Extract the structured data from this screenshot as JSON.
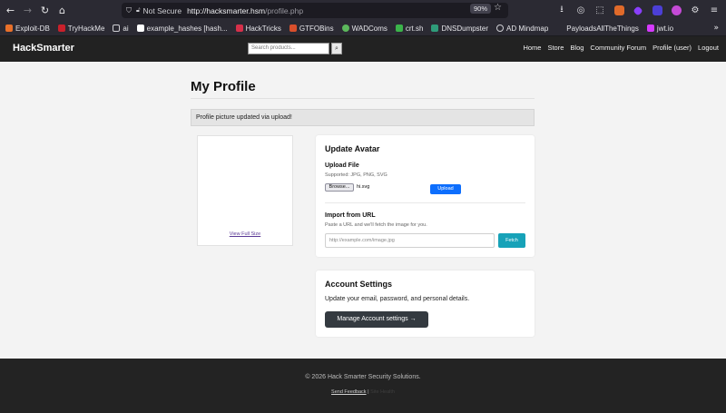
{
  "browser": {
    "security_label": "Not Secure",
    "url_host": "http://hacksmarter.hsm",
    "url_path": "/profile.php",
    "zoom": "90%",
    "bookmarks": [
      {
        "label": "Exploit-DB",
        "color": "#e8702a"
      },
      {
        "label": "TryHackMe",
        "color": "#c9202b"
      },
      {
        "label": "ai",
        "color": "#cfcfd4"
      },
      {
        "label": "example_hashes [hash...",
        "color": "#ffffff"
      },
      {
        "label": "HackTricks",
        "color": "#d6304a"
      },
      {
        "label": "GTFOBins",
        "color": "#d94f2b"
      },
      {
        "label": "WADComs",
        "color": "#5cb85c"
      },
      {
        "label": "crt.sh",
        "color": "#3bb44a"
      },
      {
        "label": "DNSDumpster",
        "color": "#2f9c7a"
      },
      {
        "label": "AD Mindmap",
        "color": "#cfcfd4"
      },
      {
        "label": "PayloadsAllTheThings",
        "color": "#2b2a33"
      },
      {
        "label": "jwt.io",
        "color": "#d63aff"
      }
    ]
  },
  "site": {
    "brand": "HackSmarter",
    "search_placeholder": "Search products...",
    "nav_links": [
      "Home",
      "Store",
      "Blog",
      "Community Forum",
      "Profile (user)",
      "Logout"
    ]
  },
  "profile": {
    "title": "My Profile",
    "alert": "Profile picture updated via upload!",
    "view_full_size": "View Full Size"
  },
  "avatar_card": {
    "heading": "Update Avatar",
    "upload_heading": "Upload File",
    "supported": "Supported: JPG, PNG, SVG",
    "browse_label": "Browse...",
    "file_name": "hi.svg",
    "upload_label": "Upload",
    "import_heading": "Import from URL",
    "import_hint": "Paste a URL and we'll fetch the image for you.",
    "url_placeholder": "http://example.com/image.jpg",
    "fetch_label": "Fetch"
  },
  "account_card": {
    "heading": "Account Settings",
    "text": "Update your email, password, and personal details.",
    "button": "Manage Account settings →"
  },
  "footer": {
    "copyright": "© 2026 Hack Smarter Security Solutions.",
    "feedback": "Send Feedback",
    "separator": "|",
    "hidden_link": "Site Health"
  },
  "colors": {
    "primary": "#0d6efd",
    "info": "#17a2b8",
    "dark": "#343a40",
    "navbar": "#222222"
  }
}
